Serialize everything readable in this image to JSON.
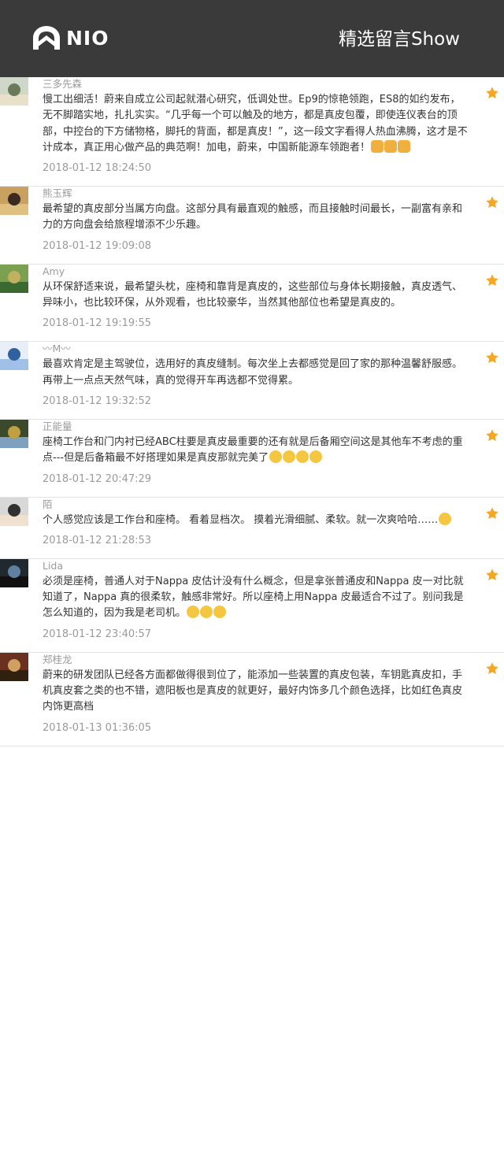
{
  "header": {
    "brand": "NIO",
    "title": "精选留言Show"
  },
  "colors": {
    "header_bg": "#3a3a3a",
    "star": "#f5a623",
    "name": "#9a9a9a",
    "text": "#333333"
  },
  "comments": [
    {
      "name": "三多先森",
      "text": "慢工出细活！蔚来自成立公司起就潜心研究，低调处世。Ep9的惊艳领跑，ES8的如约发布，无不脚踏实地，扎扎实实。“几乎每一个可以触及的地方，都是真皮包覆，即使连仪表台的顶部，中控台的下方储物格，脚托的背面，都是真皮！”，这一段文字看得人热血沸腾，这才是不计成本，真正用心做产品的典范啊！加电，蔚来，中国新能源车领跑者！",
      "emojis": [
        "thumbs-up-emoji",
        "thumbs-up-emoji",
        "thumbs-up-emoji"
      ],
      "time": "2018-01-12 18:24:50",
      "starred": true
    },
    {
      "name": "熊玉辉",
      "text": "最希望的真皮部分当属方向盘。这部分具有最直观的触感，而且接触时间最长，一副富有亲和力的方向盘会给旅程增添不少乐趣。",
      "emojis": [],
      "time": "2018-01-12 19:09:08",
      "starred": true
    },
    {
      "name": "Amy",
      "text": "从环保舒适来说，最希望头枕，座椅和靠背是真皮的，这些部位与身体长期接触，真皮透气、异味小，也比较环保，从外观看，也比较豪华，当然其他部位也希望是真皮的。",
      "emojis": [],
      "time": "2018-01-12 19:19:55",
      "starred": true
    },
    {
      "name": "〰M〰",
      "text": "最喜欢肯定是主驾驶位，选用好的真皮缝制。每次坐上去都感觉是回了家的那种温馨舒服感。再带上一点点天然气味，真的觉得开车再选都不觉得累。",
      "emojis": [],
      "time": "2018-01-12 19:32:52",
      "starred": true
    },
    {
      "name": "正能量",
      "text": "座椅工作台和门内衬已经ABC柱要是真皮最重要的还有就是后备厢空间这是其他车不考虑的重点---但是后备箱最不好搭理如果是真皮那就完美了",
      "emojis": [
        "grin-emoji",
        "grin-emoji",
        "grin-emoji",
        "grin-emoji"
      ],
      "time": "2018-01-12 20:47:29",
      "starred": true
    },
    {
      "name": "陌",
      "text": "个人感觉应该是工作台和座椅。 看着显档次。 摸着光滑细腻、柔软。就一次爽哈哈……",
      "emojis": [
        "laugh-emoji"
      ],
      "time": "2018-01-12 21:28:53",
      "starred": true
    },
    {
      "name": "Lida",
      "text": "必须是座椅，普通人对于Nappa 皮估计没有什么概念，但是拿张普通皮和Nappa 皮一对比就知道了，Nappa 真的很柔软，触感非常好。所以座椅上用Nappa 皮最适合不过了。别问我是怎么知道的，因为我是老司机。",
      "emojis": [
        "wink-tongue-emoji",
        "wink-tongue-emoji",
        "wink-tongue-emoji"
      ],
      "time": "2018-01-12 23:40:57",
      "starred": true
    },
    {
      "name": "郑桂龙",
      "text": "蔚来的研发团队已经各方面都做得很到位了，能添加一些装置的真皮包装，车钥匙真皮扣，手机真皮套之类的也不错，遮阳板也是真皮的就更好，最好内饰多几个颜色选择，比如红色真皮内饰更高档",
      "emojis": [],
      "time": "2018-01-13 01:36:05",
      "starred": true
    }
  ]
}
